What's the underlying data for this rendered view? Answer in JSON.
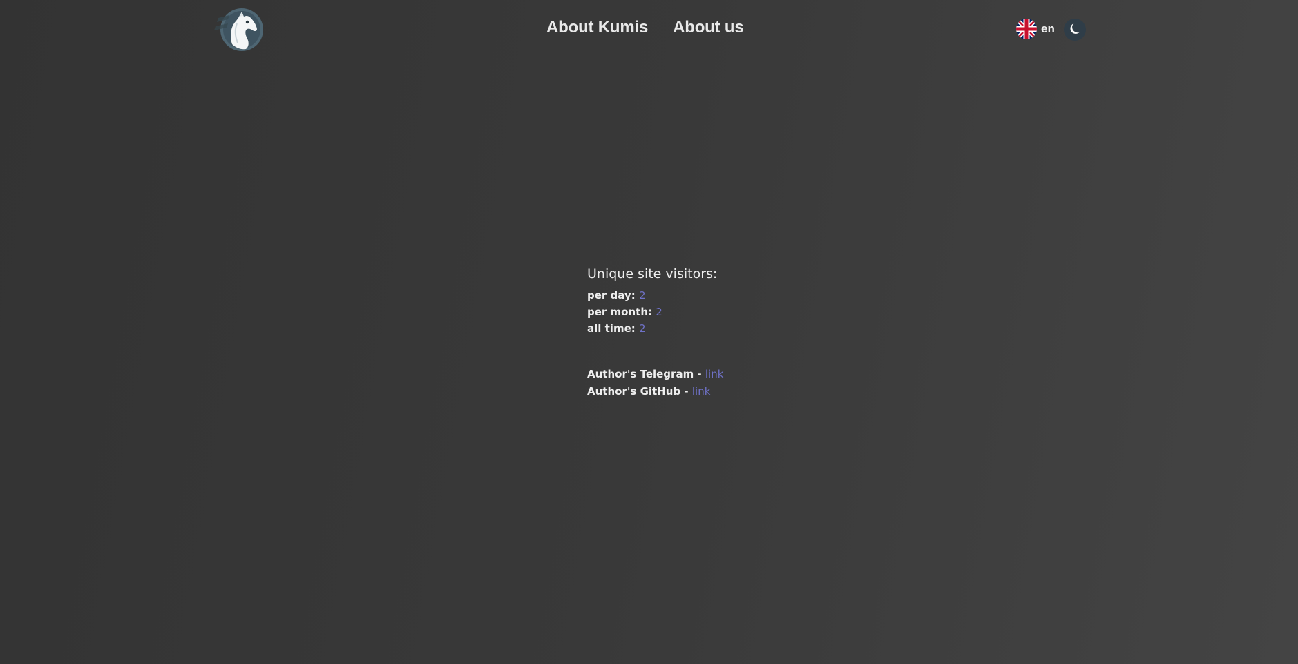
{
  "header": {
    "logo_icon": "horse-head-logo-icon",
    "nav": [
      {
        "label": "About Kumis"
      },
      {
        "label": "About us"
      }
    ],
    "language": {
      "flag_icon": "uk-flag-icon",
      "code": "en"
    },
    "theme_toggle": {
      "icon": "moon-icon"
    }
  },
  "stats": {
    "title": "Unique site visitors:",
    "rows": [
      {
        "label": "per day:",
        "value": "2"
      },
      {
        "label": "per month:",
        "value": "2"
      },
      {
        "label": "all time:",
        "value": "2"
      }
    ]
  },
  "links": [
    {
      "label": "Author's Telegram - ",
      "link_text": "link"
    },
    {
      "label": "Author's GitHub - ",
      "link_text": "link"
    }
  ],
  "colors": {
    "accent": "#6f72c8",
    "background": "#393939",
    "text": "#eeeeee",
    "toggle_bg": "#2f3d48"
  }
}
